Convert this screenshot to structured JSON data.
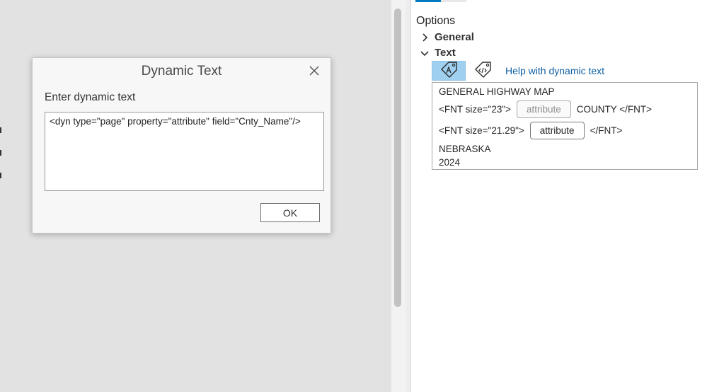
{
  "dialog": {
    "title": "Dynamic Text",
    "label": "Enter dynamic text",
    "input_value": "<dyn type=\"page\" property=\"attribute\" field=\"Cnty_Name\"/>",
    "ok_label": "OK"
  },
  "options": {
    "title": "Options",
    "groups": [
      {
        "label": "General",
        "expanded": false
      },
      {
        "label": "Text",
        "expanded": true
      }
    ],
    "help_link": "Help with dynamic text",
    "text_box": {
      "line1": "GENERAL HIGHWAY MAP",
      "line2": {
        "prefix": "<FNT size=\"23\">",
        "chip": "attribute",
        "suffix": "COUNTY </FNT>"
      },
      "line3": {
        "prefix": "<FNT size=\"21.29\">",
        "chip": "attribute",
        "suffix": "</FNT>"
      },
      "line4": "NEBRASKA",
      "line5": "2024"
    }
  },
  "colors": {
    "accent": "#0079c1",
    "selected_tool": "#9fd0f0",
    "link": "#0f5fa3"
  },
  "icons": [
    "close-icon",
    "chevron-right-icon",
    "chevron-down-icon",
    "tag-text-icon",
    "tag-code-icon"
  ]
}
